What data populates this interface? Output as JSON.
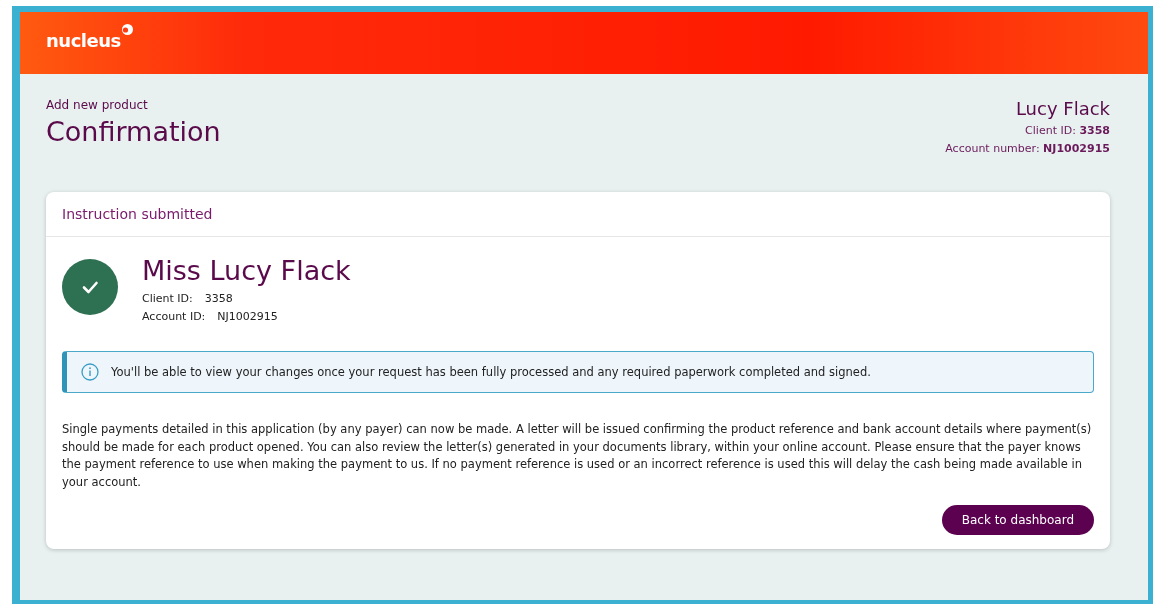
{
  "header": {
    "logo": "nucleus"
  },
  "page": {
    "breadcrumb": "Add new product",
    "title": "Confirmation"
  },
  "client": {
    "name": "Lucy Flack",
    "client_id": "Client ID: **3358**",
    "account_number": "Account number: **NJ1002915**"
  },
  "card": {
    "heading": "Instruction submitted",
    "success": true,
    "full_name": "Miss Lucy Flack",
    "details": [
      {
        "label": "Client ID:",
        "value": "3358"
      },
      {
        "label": "Account ID:",
        "value": "NJ1002915"
      }
    ],
    "info": "You'll be able to view your changes once your request has been fully processed and any required paperwork completed and signed.",
    "body": "Single payments detailed in this application (by any payer) can now be made. A letter will be issued confirming the product reference and bank account details where payment(s) should be made for each product opened. You can also review the letter(s) generated in your documents library, within your online account. Please ensure that the payer knows the payment reference to use when making the payment to us. If no payment reference is used or an incorrect reference is used this will delay the cash being made available in your account.",
    "button": "Back to dashboard"
  }
}
